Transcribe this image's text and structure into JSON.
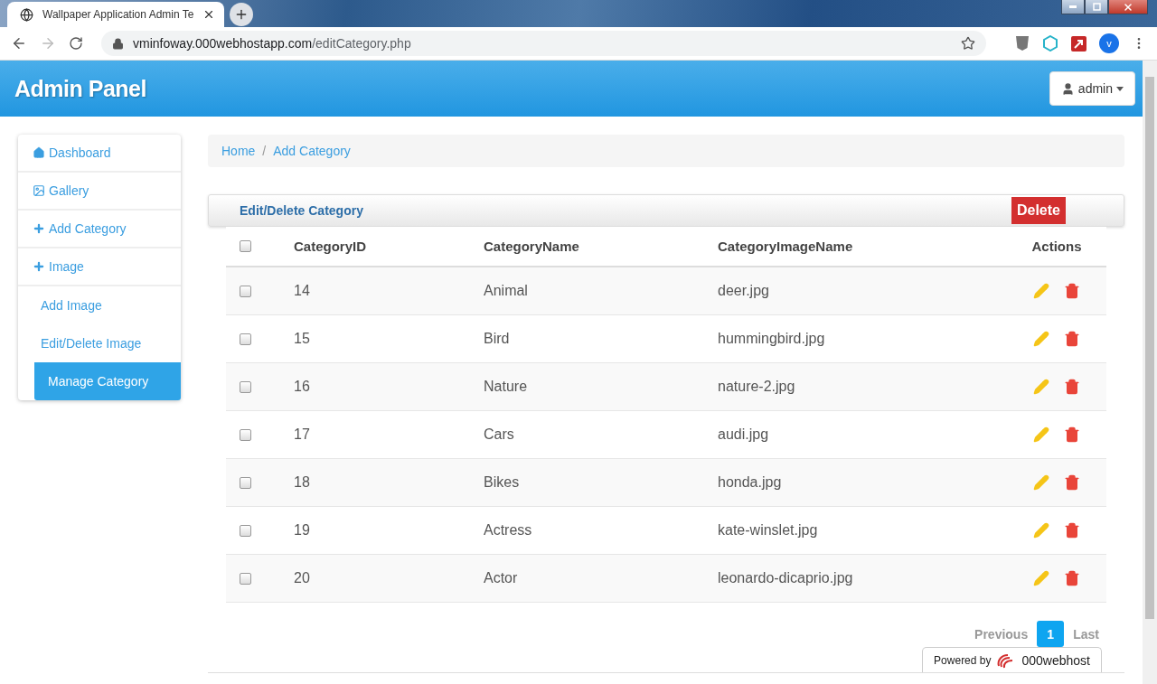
{
  "browser": {
    "tab_title": "Wallpaper Application Admin Te",
    "url_host": "vminfoway.000webhostapp.com",
    "url_path": "/editCategory.php",
    "avatar_letter": "v"
  },
  "header": {
    "title": "Admin Panel",
    "user_button": "admin"
  },
  "sidebar": {
    "items": [
      {
        "label": "Dashboard",
        "kind": "home",
        "selected": false
      },
      {
        "label": "Gallery",
        "kind": "picture",
        "selected": false
      },
      {
        "label": "Add Category",
        "kind": "plus",
        "selected": false
      },
      {
        "label": "Image",
        "kind": "plus",
        "selected": false,
        "children": [
          {
            "label": "Add Image",
            "selected": false
          },
          {
            "label": "Edit/Delete Image",
            "selected": false
          },
          {
            "label": "Manage Category",
            "selected": true
          }
        ]
      }
    ]
  },
  "breadcrumb": [
    "Home",
    "Add Category"
  ],
  "breadcrumb_separator": "/",
  "panel": {
    "title": "Edit/Delete Category",
    "delete_button": "Delete"
  },
  "table": {
    "select_all_checked": false,
    "columns": [
      "CategoryID",
      "CategoryName",
      "CategoryImageName",
      "Actions"
    ],
    "rows": [
      {
        "checked": false,
        "cells": [
          "14",
          "Animal",
          "deer.jpg"
        ]
      },
      {
        "checked": false,
        "cells": [
          "15",
          "Bird",
          "hummingbird.jpg"
        ]
      },
      {
        "checked": false,
        "cells": [
          "16",
          "Nature",
          "nature-2.jpg"
        ]
      },
      {
        "checked": false,
        "cells": [
          "17",
          "Cars",
          "audi.jpg"
        ]
      },
      {
        "checked": false,
        "cells": [
          "18",
          "Bikes",
          "honda.jpg"
        ]
      },
      {
        "checked": false,
        "cells": [
          "19",
          "Actress",
          "kate-winslet.jpg"
        ]
      },
      {
        "checked": false,
        "cells": [
          "20",
          "Actor",
          "leonardo-dicaprio.jpg"
        ]
      }
    ]
  },
  "pagination": {
    "previous": "Previous",
    "pages": [
      {
        "label": "1",
        "selected": true
      }
    ],
    "last": "Last"
  },
  "footer": {
    "powered_by": "Powered by",
    "brand": "000webhost"
  }
}
